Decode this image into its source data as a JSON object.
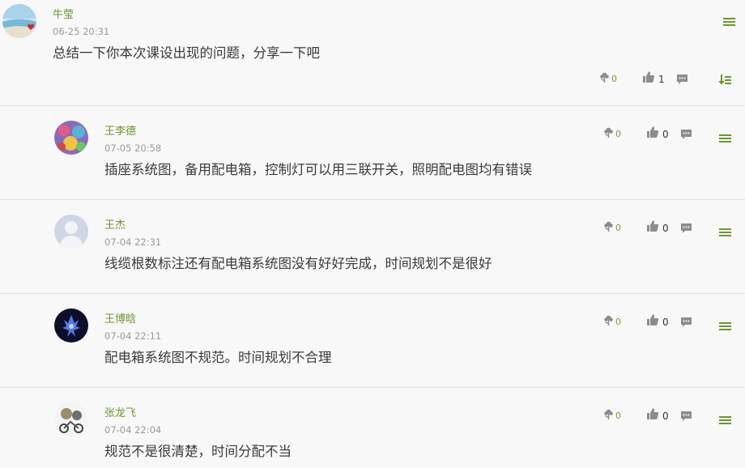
{
  "post": {
    "author": "牛莹",
    "time": "06-25 20:31",
    "text": "总结一下你本次课设出现的问题，分享一下吧",
    "flowers": "0",
    "likes": "1"
  },
  "replies": [
    {
      "author": "王李德",
      "time": "07-05 20:58",
      "text": "插座系统图，备用配电箱，控制灯可以用三联开关，照明配电图均有错误",
      "flowers": "0",
      "likes": "0"
    },
    {
      "author": "王杰",
      "time": "07-04 22:31",
      "text": "线缆根数标注还有配电箱系统图没有好好完成，时间规划不是很好",
      "flowers": "0",
      "likes": "0"
    },
    {
      "author": "王博晗",
      "time": "07-04 22:11",
      "text": "配电箱系统图不规范。时间规划不合理",
      "flowers": "0",
      "likes": "0"
    },
    {
      "author": "张龙飞",
      "time": "07-04 22:04",
      "text": "规范不是很清楚，时间分配不当",
      "flowers": "0",
      "likes": "0"
    }
  ],
  "colors": {
    "accent": "#6f9431",
    "icon": "#8c8c8c",
    "muted": "#9a9a9a",
    "divider": "#e2e2e2"
  },
  "icons": [
    "flower-icon",
    "thumbs-up-icon",
    "comment-icon",
    "menu-icon",
    "sort-icon"
  ]
}
